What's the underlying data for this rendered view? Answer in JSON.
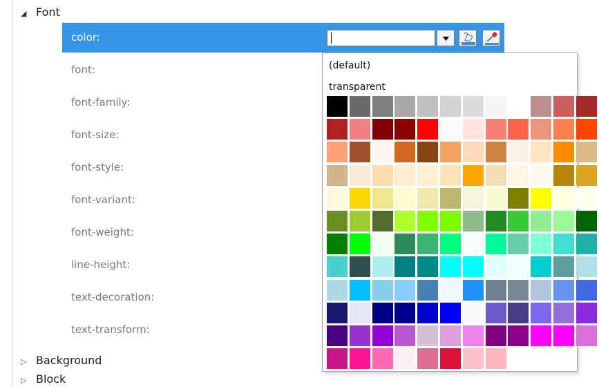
{
  "tree": {
    "font_category": "Font",
    "properties": [
      "color:",
      "font:",
      "font-family:",
      "font-size:",
      "font-style:",
      "font-variant:",
      "font-weight:",
      "line-height:",
      "text-decoration:",
      "text-transform:"
    ],
    "selected_property_index": 0,
    "collapsed_categories": [
      "Background",
      "Block"
    ]
  },
  "color_editor": {
    "value": "",
    "icons": [
      "dropdown-arrow-icon",
      "paint-bucket-icon",
      "eyedropper-icon"
    ]
  },
  "color_popup": {
    "default_label": "(default)",
    "transparent_label": "transparent",
    "swatch_rows": [
      [
        "#000000",
        "#696969",
        "#808080",
        "#a9a9a9",
        "#c0c0c0",
        "#d3d3d3",
        "#dcdcdc",
        "#f5f5f5",
        "#ffffff",
        "#bc8f8f",
        "#cd5c5c",
        "#a52a2a"
      ],
      [
        "#b22222",
        "#f08080",
        "#800000",
        "#8b0000",
        "#ff0000",
        "#fffafa",
        "#ffe4e1",
        "#fa8072",
        "#ff6347",
        "#e9967a",
        "#ff7f50",
        "#ff4500"
      ],
      [
        "#ffa07a",
        "#a0522d",
        "#fff5ee",
        "#d2691e",
        "#8b4513",
        "#f4a460",
        "#ffdab9",
        "#cd853f",
        "#faf0e6",
        "#ffe4c4",
        "#ff8c00",
        "#deb887"
      ],
      [
        "#d2b48c",
        "#faebd7",
        "#ffdead",
        "#ffebcd",
        "#ffefd5",
        "#ffe4b5",
        "#ffa500",
        "#f5deb3",
        "#fdf5e6",
        "#fffaf0",
        "#b8860b",
        "#daa520"
      ],
      [
        "#fff8dc",
        "#ffd700",
        "#f0e68c",
        "#fffacd",
        "#eee8aa",
        "#bdb76b",
        "#f5f5dc",
        "#fafad2",
        "#808000",
        "#ffff00",
        "#ffffe0",
        "#fffff0"
      ],
      [
        "#6b8e23",
        "#9acd32",
        "#556b2f",
        "#adff2f",
        "#7fff00",
        "#7cfc00",
        "#8fbc8f",
        "#228b22",
        "#32cd32",
        "#90ee90",
        "#98fb98",
        "#006400"
      ],
      [
        "#008000",
        "#00ff00",
        "#f0fff0",
        "#2e8b57",
        "#3cb371",
        "#00ff7f",
        "#f5fffa",
        "#00fa9a",
        "#66cdaa",
        "#7fffd4",
        "#40e0d0",
        "#20b2aa"
      ],
      [
        "#48d1cc",
        "#2f4f4f",
        "#afeeee",
        "#008080",
        "#008b8b",
        "#00ffff",
        "#00ffff",
        "#e0ffff",
        "#f0ffff",
        "#00ced1",
        "#5f9ea0",
        "#b0e0e6"
      ],
      [
        "#add8e6",
        "#00bfff",
        "#87ceeb",
        "#87cefa",
        "#4682b4",
        "#f0f8ff",
        "#1e90ff",
        "#708090",
        "#778899",
        "#b0c4de",
        "#6495ed",
        "#4169e1"
      ],
      [
        "#191970",
        "#e6e6fa",
        "#000080",
        "#00008b",
        "#0000cd",
        "#0000ff",
        "#f8f8ff",
        "#6a5acd",
        "#483d8b",
        "#7b68ee",
        "#9370db",
        "#8a2be2"
      ],
      [
        "#4b0082",
        "#9932cc",
        "#9400d3",
        "#ba55d3",
        "#d8bfd8",
        "#dda0dd",
        "#ee82ee",
        "#800080",
        "#8b008b",
        "#ff00ff",
        "#ff00ff",
        "#da70d6"
      ],
      [
        "#c71585",
        "#ff1493",
        "#ff69b4",
        "#fff0f5",
        "#db7093",
        "#dc143c",
        "#ffc0cb",
        "#ffb6c1"
      ]
    ]
  }
}
